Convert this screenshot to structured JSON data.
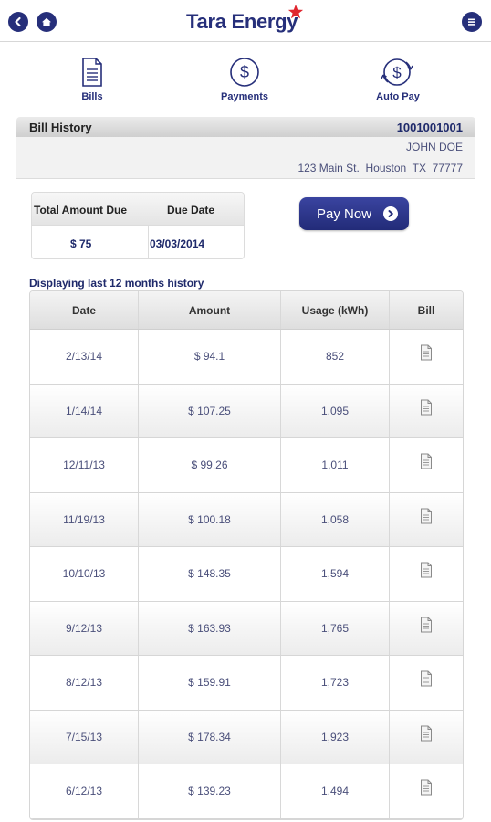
{
  "header": {
    "logo_text": "Tara Energy",
    "icons": {
      "back": "back-arrow-icon",
      "home": "home-icon",
      "menu": "menu-icon"
    }
  },
  "nav": [
    {
      "label": "Bills",
      "icon": "bills-document-icon"
    },
    {
      "label": "Payments",
      "icon": "payments-dollar-icon"
    },
    {
      "label": "Auto Pay",
      "icon": "auto-pay-icon"
    }
  ],
  "bill_history": {
    "title": "Bill History",
    "account_number": "1001001001",
    "customer_name": "JOHN DOE",
    "address": "123 Main St.  Houston  TX  77777"
  },
  "amount_due": {
    "total_label": "Total Amount Due",
    "date_label": "Due Date",
    "total_value": "$ 75",
    "date_value": "03/03/2014"
  },
  "pay_button": {
    "label": "Pay Now"
  },
  "history_note": "Displaying last 12 months history",
  "table": {
    "columns": [
      "Date",
      "Amount",
      "Usage (kWh)",
      "Bill"
    ],
    "rows": [
      {
        "date": "2/13/14",
        "amount": "$ 94.1",
        "usage": "852"
      },
      {
        "date": "1/14/14",
        "amount": "$ 107.25",
        "usage": "1,095"
      },
      {
        "date": "12/11/13",
        "amount": "$ 99.26",
        "usage": "1,011"
      },
      {
        "date": "11/19/13",
        "amount": "$ 100.18",
        "usage": "1,058"
      },
      {
        "date": "10/10/13",
        "amount": "$ 148.35",
        "usage": "1,594"
      },
      {
        "date": "9/12/13",
        "amount": "$ 163.93",
        "usage": "1,765"
      },
      {
        "date": "8/12/13",
        "amount": "$ 159.91",
        "usage": "1,723"
      },
      {
        "date": "7/15/13",
        "amount": "$ 178.34",
        "usage": "1,923"
      },
      {
        "date": "6/12/13",
        "amount": "$ 139.23",
        "usage": "1,494"
      }
    ]
  },
  "colors": {
    "brand_navy": "#262f7a",
    "brand_red": "#e0262f"
  }
}
